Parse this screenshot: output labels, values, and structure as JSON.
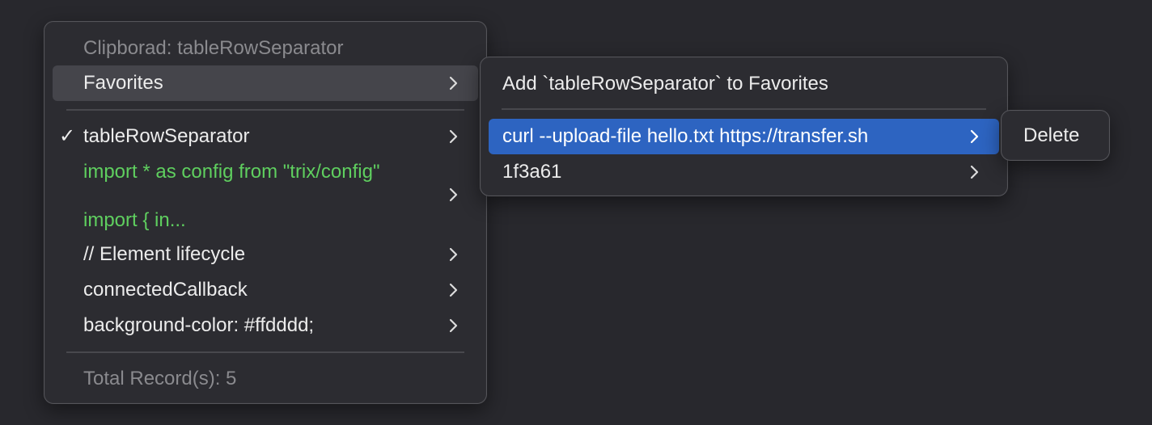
{
  "main_menu": {
    "header": "Clipborad: tableRowSeparator",
    "favorites_label": "Favorites",
    "records": [
      {
        "label": "tableRowSeparator",
        "checked": true,
        "style": "normal"
      },
      {
        "label": "import * as config from \"trix/config\"",
        "style": "green"
      },
      {
        "label": "import { in...",
        "style": "green"
      },
      {
        "label": "// Element lifecycle",
        "style": "normal"
      },
      {
        "label": "connectedCallback",
        "style": "normal"
      },
      {
        "label": "background-color: #ffdddd;",
        "style": "normal"
      }
    ],
    "checkmark": "✓",
    "footer": "Total Record(s): 5"
  },
  "favorites_menu": {
    "add_label": "Add `tableRowSeparator` to Favorites",
    "items": [
      {
        "label": "curl --upload-file hello.txt https://transfer.sh",
        "selected": true
      },
      {
        "label": "1f3a61",
        "selected": false
      }
    ]
  },
  "item_menu": {
    "delete_label": "Delete"
  },
  "icons": {
    "chevron": "chevron-right-icon",
    "check": "checkmark-icon"
  },
  "colors": {
    "background": "#28282d",
    "menu": "#2c2c31",
    "selection": "#2d64c1",
    "hover": "#45454b",
    "green_text": "#5fcf5f",
    "disabled_text": "#8a8a8e"
  }
}
